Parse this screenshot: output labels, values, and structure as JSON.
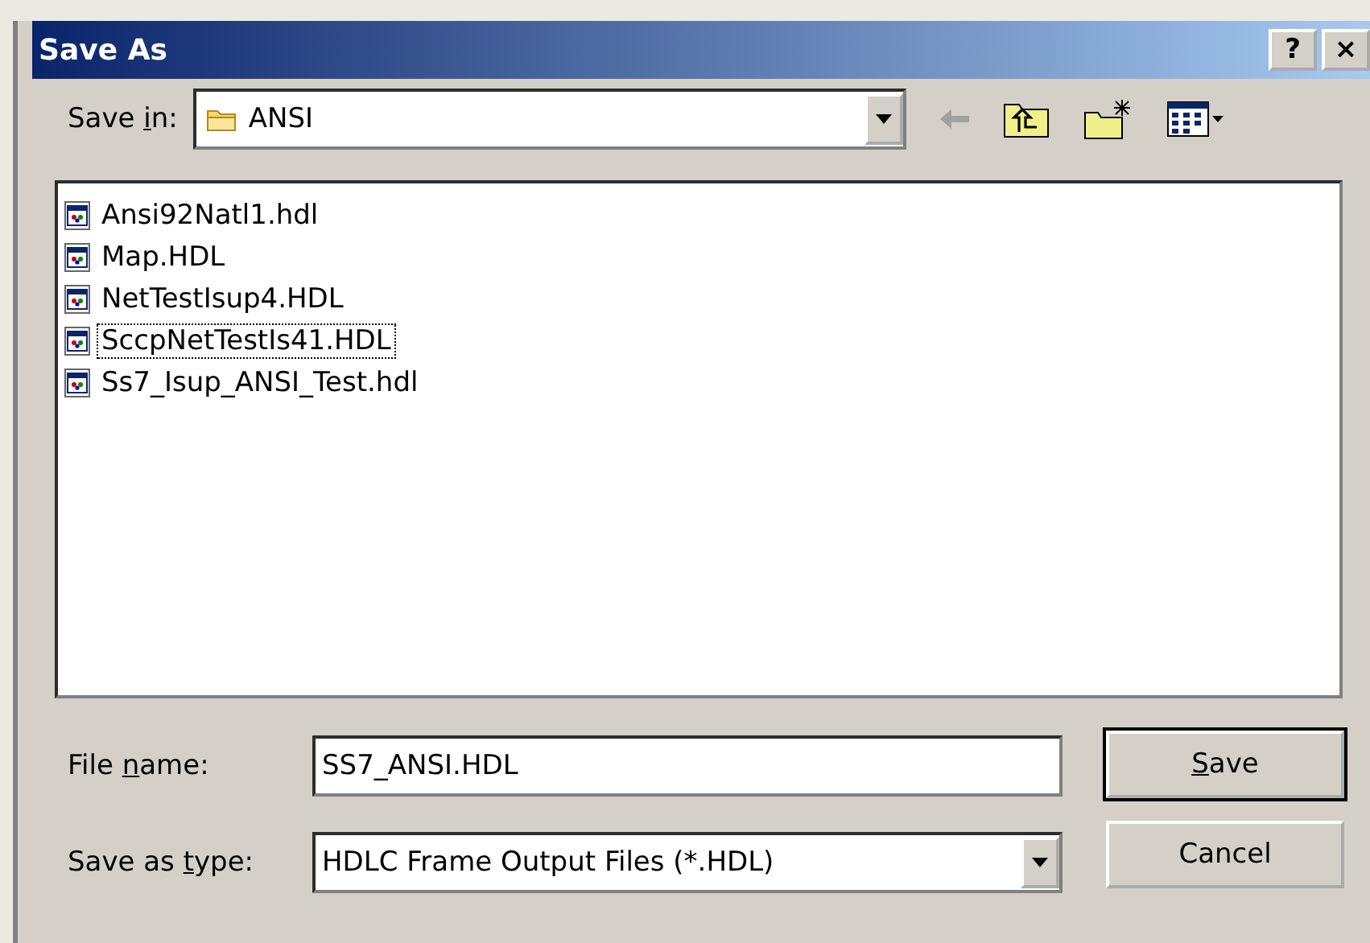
{
  "window": {
    "title": "Save As",
    "title_buttons": [
      "?",
      "×"
    ]
  },
  "save_in": {
    "label": {
      "before": "Save ",
      "key": "i",
      "after": "n:"
    },
    "value": "ANSI"
  },
  "files": [
    {
      "name": "Ansi92Natl1.hdl",
      "focused": false
    },
    {
      "name": "Map.HDL",
      "focused": false
    },
    {
      "name": "NetTestIsup4.HDL",
      "focused": false
    },
    {
      "name": "SccpNetTestIs41.HDL",
      "focused": true
    },
    {
      "name": "Ss7_Isup_ANSI_Test.hdl",
      "focused": false
    }
  ],
  "file_name": {
    "label": {
      "before": "File ",
      "key": "n",
      "after": "ame:"
    },
    "value": "SS7_ANSI.HDL"
  },
  "save_as_type": {
    "label": {
      "before": "Save as ",
      "key": "t",
      "after": "ype:"
    },
    "value": "HDLC Frame Output Files (*.HDL)"
  },
  "buttons": [
    {
      "label": {
        "key": "S",
        "after": "ave"
      },
      "default": true
    },
    {
      "label": {
        "before": "Cancel"
      },
      "default": false
    }
  ]
}
